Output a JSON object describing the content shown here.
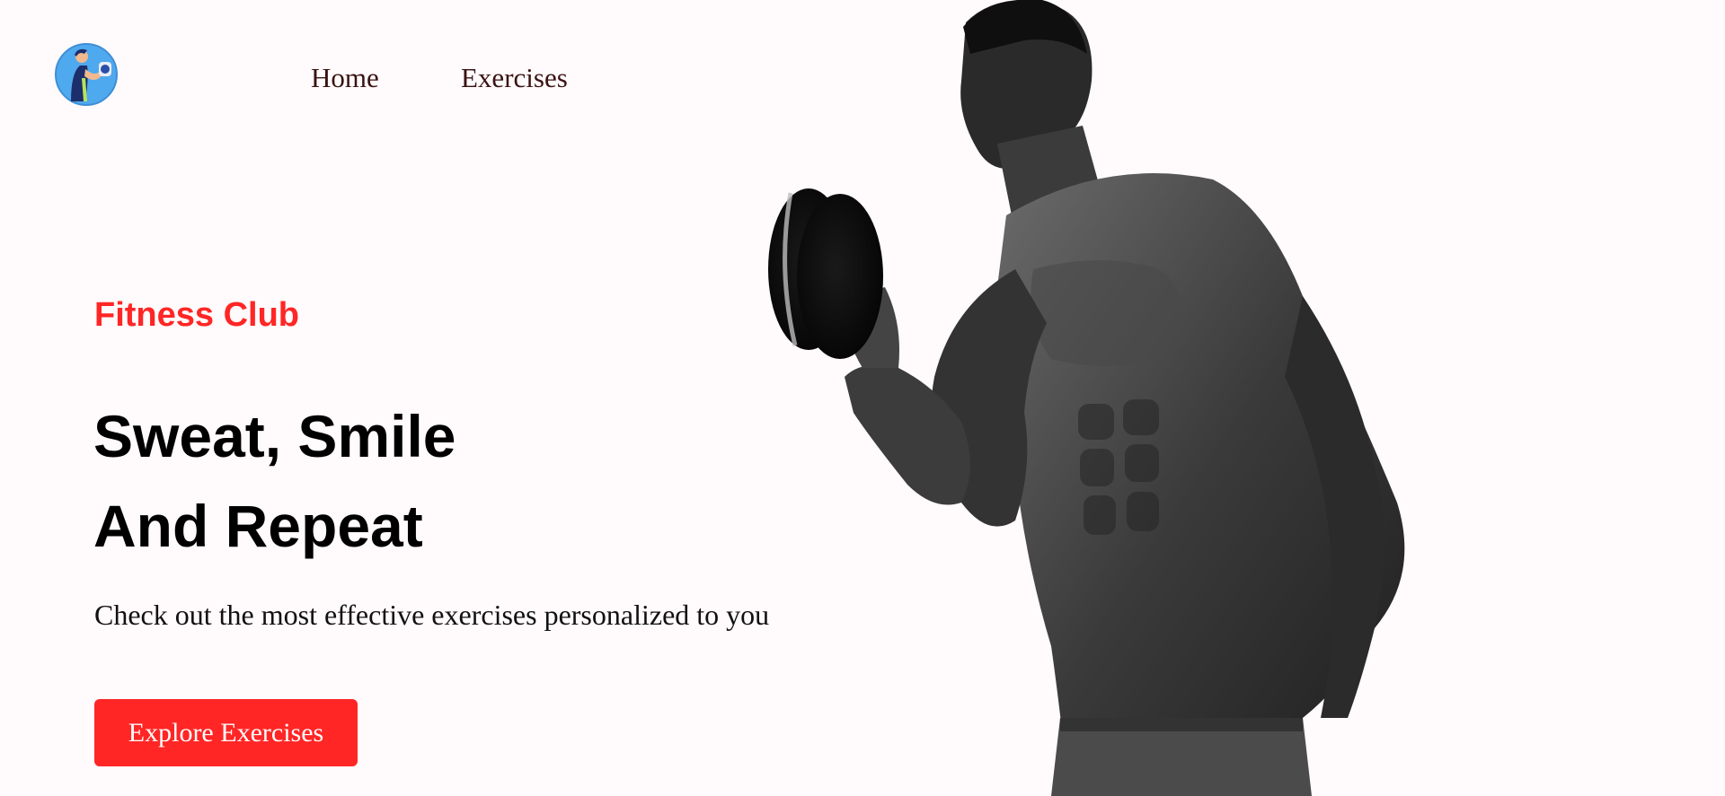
{
  "nav": {
    "logo_icon": "fitness-logo-icon",
    "links": [
      {
        "label": "Home"
      },
      {
        "label": "Exercises"
      }
    ]
  },
  "hero": {
    "brand": "Fitness Club",
    "title_line_1": "Sweat, Smile",
    "title_line_2": "And Repeat",
    "subtitle": "Check out the most effective exercises personalized to you",
    "button_label": "Explore Exercises",
    "image_icon": "bodybuilder-with-dumbbell-image"
  },
  "colors": {
    "accent": "#FF2625",
    "background": "#FFFAFB",
    "nav_text": "#3A1212"
  }
}
